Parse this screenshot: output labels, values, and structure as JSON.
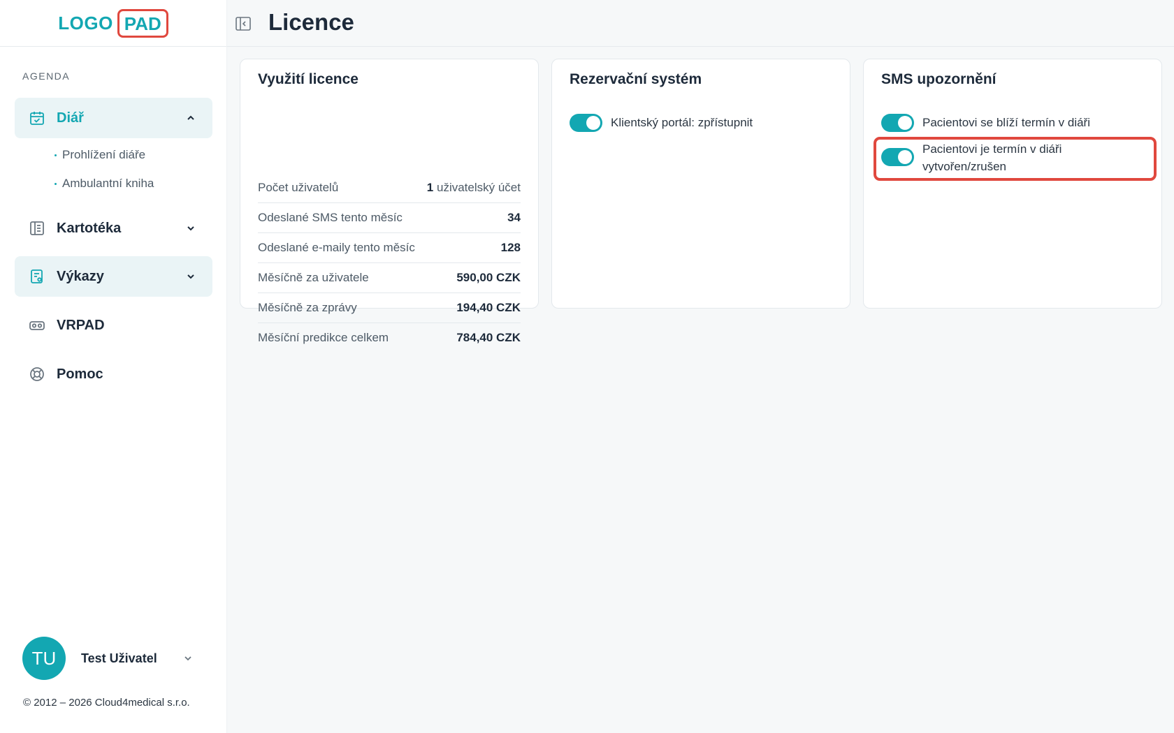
{
  "logo": {
    "part1": "LOGO",
    "part2": "PAD"
  },
  "sidebar": {
    "section_label": "AGENDA",
    "items": [
      {
        "label": "Diář",
        "icon": "calendar-check-icon",
        "expanded": true
      },
      {
        "label": "Kartotéka",
        "icon": "card-index-icon",
        "expanded": false
      },
      {
        "label": "Výkazy",
        "icon": "report-icon",
        "expanded": false
      },
      {
        "label": "VRPAD",
        "icon": "vr-headset-icon"
      },
      {
        "label": "Pomoc",
        "icon": "lifebuoy-icon"
      }
    ],
    "sub_items": [
      "Prohlížení diáře",
      "Ambulantní kniha"
    ],
    "user": {
      "initials": "TU",
      "name": "Test Uživatel"
    },
    "copyright": "© 2012 – 2026 Cloud4medical s.r.o."
  },
  "header": {
    "title": "Licence"
  },
  "license_card": {
    "title": "Využití licence",
    "rows": [
      {
        "label": "Počet uživatelů",
        "value": "1",
        "unit": " uživatelský účet"
      },
      {
        "label": "Odeslané SMS tento měsíc",
        "value": "34",
        "unit": ""
      },
      {
        "label": "Odeslané e-maily tento měsíc",
        "value": "128",
        "unit": ""
      },
      {
        "label": "Měsíčně za uživatele",
        "value": "590,00 CZK",
        "unit": ""
      },
      {
        "label": "Měsíčně za zprávy",
        "value": "194,40 CZK",
        "unit": ""
      },
      {
        "label": "Měsíční predikce celkem",
        "value": "784,40 CZK",
        "unit": ""
      }
    ]
  },
  "reservation_card": {
    "title": "Rezervační systém",
    "toggles": [
      {
        "label": "Klientský portál: zpřístupnit",
        "on": true
      }
    ]
  },
  "sms_card": {
    "title": "SMS upozornění",
    "toggles": [
      {
        "label": "Pacientovi se blíží termín v diáři",
        "on": true
      },
      {
        "label_line1": "Pacientovi je termín v diáři",
        "label_line2": "vytvořen/zrušen",
        "on": true
      }
    ]
  },
  "colors": {
    "accent": "#13a7b2",
    "highlight": "#e0483e",
    "text": "#1d2a3a"
  }
}
